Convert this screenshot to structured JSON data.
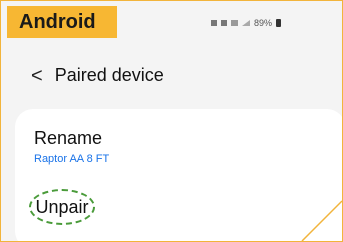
{
  "badge": {
    "label": "Android",
    "color": "#f7b733"
  },
  "status_bar": {
    "battery": "89%"
  },
  "header": {
    "back_icon": "chevron-left-icon",
    "back_glyph": "<",
    "title": "Paired device"
  },
  "rename": {
    "label": "Rename",
    "value": "Raptor AA 8 FT"
  },
  "unpair": {
    "label": "Unpair"
  },
  "colors": {
    "accent": "#f7b733",
    "link": "#1a73e8",
    "highlight": "#4a9b3a"
  }
}
